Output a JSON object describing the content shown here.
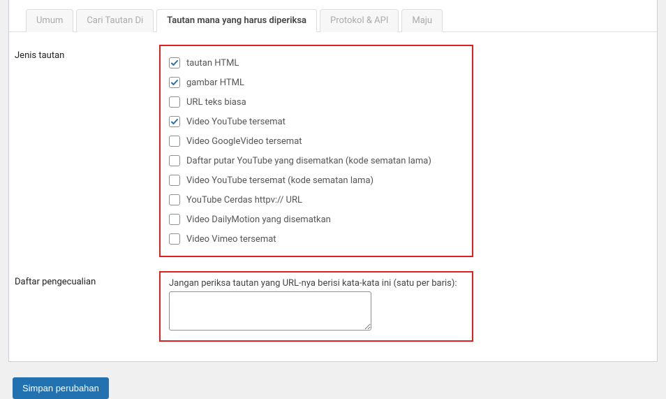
{
  "tabs": [
    {
      "label": "Umum",
      "active": false
    },
    {
      "label": "Cari Tautan Di",
      "active": false
    },
    {
      "label": "Tautan mana yang harus diperiksa",
      "active": true
    },
    {
      "label": "Protokol & API",
      "active": false
    },
    {
      "label": "Maju",
      "active": false
    }
  ],
  "sections": {
    "linkTypes": {
      "title": "Jenis tautan",
      "items": [
        {
          "label": "tautan HTML",
          "checked": true
        },
        {
          "label": "gambar HTML",
          "checked": true
        },
        {
          "label": "URL teks biasa",
          "checked": false
        },
        {
          "label": "Video YouTube tersemat",
          "checked": true
        },
        {
          "label": "Video GoogleVideo tersemat",
          "checked": false
        },
        {
          "label": "Daftar putar YouTube yang disematkan (kode sematan lama)",
          "checked": false
        },
        {
          "label": "Video YouTube tersemat (kode sematan lama)",
          "checked": false
        },
        {
          "label": "YouTube Cerdas httpv:// URL",
          "checked": false
        },
        {
          "label": "Video DailyMotion yang disematkan",
          "checked": false
        },
        {
          "label": "Video Vimeo tersemat",
          "checked": false
        }
      ]
    },
    "exclusion": {
      "title": "Daftar pengecualian",
      "label": "Jangan periksa tautan yang URL-nya berisi kata-kata ini (satu per baris):",
      "value": ""
    }
  },
  "buttons": {
    "save": "Simpan perubahan"
  }
}
